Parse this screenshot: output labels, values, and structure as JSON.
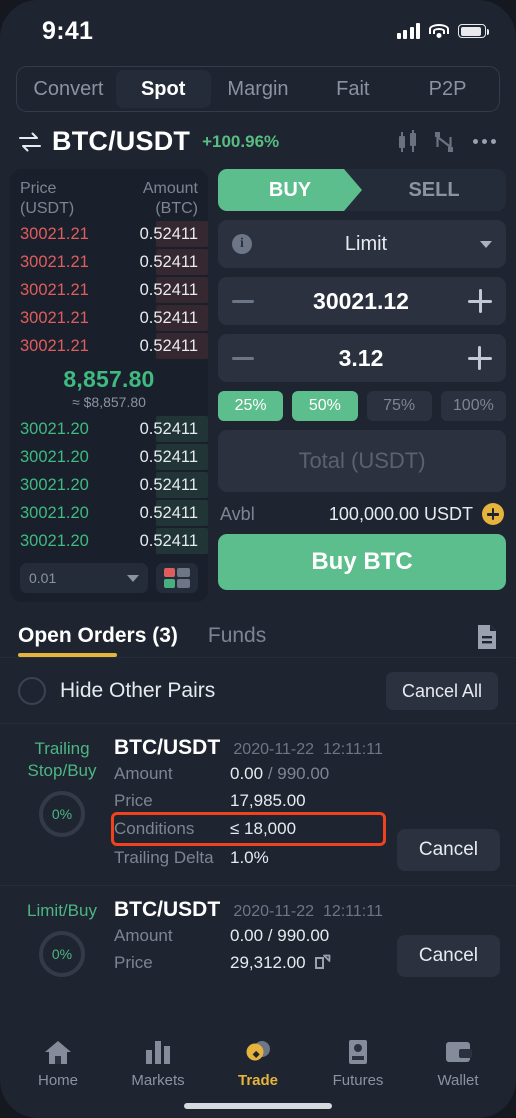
{
  "status_bar": {
    "time": "9:41",
    "signal_icon": "cellular-signal-icon",
    "wifi_icon": "wifi-icon",
    "battery_icon": "battery-icon"
  },
  "top_tabs": [
    {
      "label": "Convert",
      "active": false
    },
    {
      "label": "Spot",
      "active": true
    },
    {
      "label": "Margin",
      "active": false
    },
    {
      "label": "Fait",
      "active": false
    },
    {
      "label": "P2P",
      "active": false
    }
  ],
  "pair_header": {
    "swap_icon": "swap-arrows-icon",
    "pair": "BTC/USDT",
    "change": "+100.96%",
    "change_color": "#58bd82",
    "candlestick_icon": "candlestick-chart-icon",
    "line_chart_icon": "line-chart-icon",
    "more_icon": "more-horizontal-icon"
  },
  "order_book": {
    "col_price": "Price",
    "col_price_unit": "(USDT)",
    "col_amount": "Amount",
    "col_amount_unit": "(BTC)",
    "ask_color": "#e05d5d",
    "bid_color": "#3fba80",
    "asks": [
      {
        "price": "30021.21",
        "amount": "0.52411"
      },
      {
        "price": "30021.21",
        "amount": "0.52411"
      },
      {
        "price": "30021.21",
        "amount": "0.52411"
      },
      {
        "price": "30021.21",
        "amount": "0.52411"
      },
      {
        "price": "30021.21",
        "amount": "0.52411"
      }
    ],
    "mid_price": "8,857.80",
    "mid_price_usd": "≈ $8,857.80",
    "bids": [
      {
        "price": "30021.20",
        "amount": "0.52411"
      },
      {
        "price": "30021.20",
        "amount": "0.52411"
      },
      {
        "price": "30021.20",
        "amount": "0.52411"
      },
      {
        "price": "30021.20",
        "amount": "0.52411"
      },
      {
        "price": "30021.20",
        "amount": "0.52411"
      }
    ],
    "tick_size": "0.01",
    "tick_caret_icon": "chevron-down-icon",
    "depth_view_icon": "depth-layout-icon"
  },
  "order_form": {
    "buy_label": "BUY",
    "sell_label": "SELL",
    "active_side": "BUY",
    "info_icon": "info-icon",
    "order_type": "Limit",
    "type_caret_icon": "chevron-down-icon",
    "price_minus_icon": "minus-icon",
    "price_value": "30021.12",
    "price_plus_icon": "plus-icon",
    "amount_minus_icon": "minus-icon",
    "amount_value": "3.12",
    "amount_plus_icon": "plus-icon",
    "percents": [
      {
        "label": "25%",
        "active": true
      },
      {
        "label": "50%",
        "active": true
      },
      {
        "label": "75%",
        "active": false
      },
      {
        "label": "100%",
        "active": false
      }
    ],
    "total_placeholder": "Total (USDT)",
    "total_value": "",
    "avbl_label": "Avbl",
    "avbl_value": "100,000.00 USDT",
    "add_funds_icon": "plus-circle-icon",
    "submit_label": "Buy BTC",
    "accent_green": "#5cbd8d"
  },
  "orders_section": {
    "tabs": [
      {
        "label": "Open Orders (3)",
        "active": true
      },
      {
        "label": "Funds",
        "active": false
      }
    ],
    "underline_color": "#e6b33c",
    "history_icon": "document-icon",
    "hide_other_pairs_label": "Hide Other Pairs",
    "hide_other_pairs_checked": false,
    "cancel_all_label": "Cancel All",
    "orders": [
      {
        "type_line1": "Trailing",
        "type_line2": "Stop/Buy",
        "progress": "0%",
        "pair": "BTC/USDT",
        "date": "2020-11-22",
        "time": "12:11:11",
        "rows": [
          {
            "key": "Amount",
            "value": "0.00",
            "value_dim": " / 990.00",
            "highlight": false
          },
          {
            "key": "Price",
            "value": "17,985.00",
            "value_dim": "",
            "highlight": false
          },
          {
            "key": "Conditions",
            "value": "≤ 18,000",
            "value_dim": "",
            "highlight": true
          },
          {
            "key": "Trailing Delta",
            "value": "1.0%",
            "value_dim": "",
            "highlight": false
          }
        ],
        "edit_icon": null,
        "cancel_label": "Cancel"
      },
      {
        "type_line1": "Limit/Buy",
        "type_line2": "",
        "progress": "0%",
        "pair": "BTC/USDT",
        "date": "2020-11-22",
        "time": "12:11:11",
        "rows": [
          {
            "key": "Amount",
            "value": "0.00 / 990.00",
            "value_dim": "",
            "highlight": false
          },
          {
            "key": "Price",
            "value": "29,312.00",
            "value_dim": "",
            "highlight": false
          }
        ],
        "edit_icon": "edit-pencil-icon",
        "cancel_label": "Cancel"
      }
    ],
    "highlight_color": "#f0421f"
  },
  "bottom_nav": [
    {
      "label": "Home",
      "icon": "home-icon",
      "active": false
    },
    {
      "label": "Markets",
      "icon": "bar-chart-icon",
      "active": false
    },
    {
      "label": "Trade",
      "icon": "trade-coin-icon",
      "active": true
    },
    {
      "label": "Futures",
      "icon": "futures-icon",
      "active": false
    },
    {
      "label": "Wallet",
      "icon": "wallet-icon",
      "active": false
    }
  ],
  "home_indicator": "home-indicator"
}
